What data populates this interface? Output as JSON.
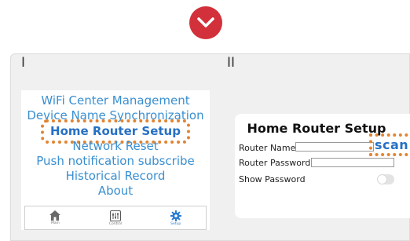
{
  "top_icon": "chevron-down-icon",
  "steps": {
    "first": "I",
    "second": "II"
  },
  "menu": {
    "items": [
      "WiFi Center Management",
      "Device Name Synchronization",
      "Home Router Setup",
      "Network Reset",
      "Push notification subscribe",
      "Historical Record",
      "About"
    ],
    "highlighted": "Home Router Setup"
  },
  "tabbar": {
    "tabs": [
      {
        "label": "Main",
        "icon": "home-icon",
        "active": false
      },
      {
        "label": "Control",
        "icon": "sliders-icon",
        "active": false
      },
      {
        "label": "Setup",
        "icon": "gear-icon",
        "active": true
      }
    ]
  },
  "router_setup": {
    "title": "Home Router Setup",
    "router_name_label": "Router Name",
    "router_name_value": "",
    "router_password_label": "Router Password",
    "router_password_value": "",
    "show_password_label": "Show Password",
    "show_password_on": false,
    "scan_label": "scan"
  },
  "colors": {
    "accent": "#d2303a",
    "link": "#3a8fd0",
    "highlight_border": "#e28432",
    "active_tab": "#2a7dd0"
  }
}
